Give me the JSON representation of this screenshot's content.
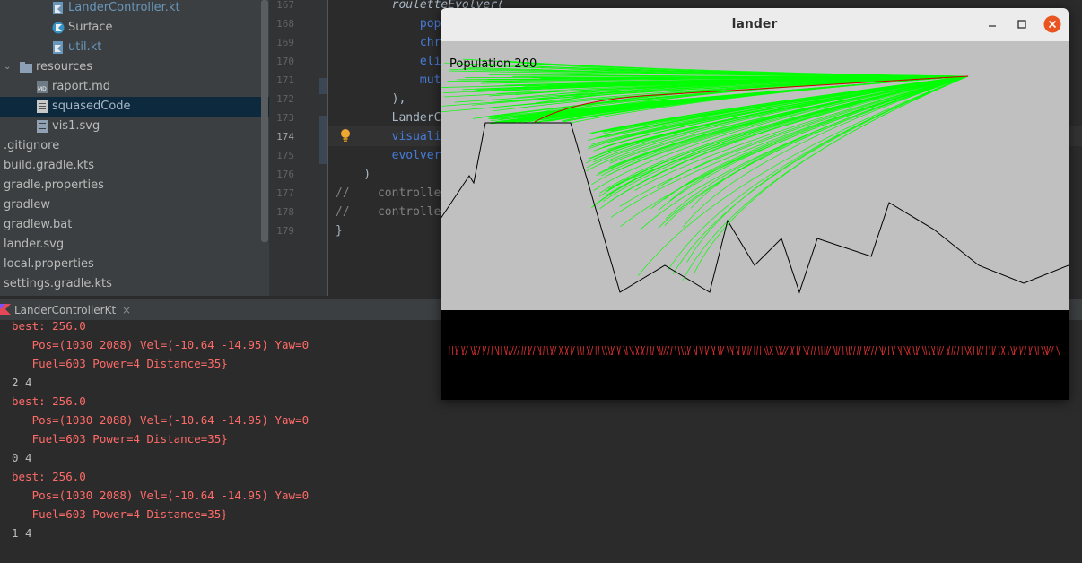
{
  "project_tree": {
    "items": [
      {
        "label": "LanderController.kt",
        "icon": "kotlin-file-icon",
        "style": "blue"
      },
      {
        "label": "Surface",
        "icon": "kotlin-class-icon",
        "style": "plain"
      },
      {
        "label": "util.kt",
        "icon": "kotlin-file-icon",
        "style": "blue"
      },
      {
        "label": "resources",
        "icon": "folder-icon",
        "style": "plain"
      },
      {
        "label": "raport.md",
        "icon": "markdown-file-icon",
        "style": "plain"
      },
      {
        "label": "squasedCode",
        "icon": "text-file-icon",
        "style": "sel"
      },
      {
        "label": "vis1.svg",
        "icon": "svg-file-icon",
        "style": "plain"
      },
      {
        "label": ".gitignore",
        "icon": "",
        "style": "plain"
      },
      {
        "label": "build.gradle.kts",
        "icon": "",
        "style": "plain"
      },
      {
        "label": "gradle.properties",
        "icon": "",
        "style": "plain"
      },
      {
        "label": "gradlew",
        "icon": "",
        "style": "plain"
      },
      {
        "label": "gradlew.bat",
        "icon": "",
        "style": "plain"
      },
      {
        "label": "lander.svg",
        "icon": "",
        "style": "plain"
      },
      {
        "label": "local.properties",
        "icon": "",
        "style": "plain"
      },
      {
        "label": "settings.gradle.kts",
        "icon": "",
        "style": "plain"
      }
    ]
  },
  "editor": {
    "line_numbers": [
      "167",
      "168",
      "169",
      "170",
      "171",
      "172",
      "173",
      "174",
      "175",
      "176",
      "177",
      "178",
      "179"
    ],
    "current_line": "174",
    "lines": [
      [
        {
          "t": "        ",
          "c": "plain"
        },
        {
          "t": "rouletteEvolver(",
          "c": "func"
        }
      ],
      [
        {
          "t": "            ",
          "c": "plain"
        },
        {
          "t": "pop",
          "c": "param"
        }
      ],
      [
        {
          "t": "            ",
          "c": "plain"
        },
        {
          "t": "chr",
          "c": "param"
        }
      ],
      [
        {
          "t": "            ",
          "c": "plain"
        },
        {
          "t": "eli",
          "c": "param"
        }
      ],
      [
        {
          "t": "            ",
          "c": "plain"
        },
        {
          "t": "mut",
          "c": "param"
        }
      ],
      [
        {
          "t": "        ),",
          "c": "plain"
        }
      ],
      [
        {
          "t": "        LanderC",
          "c": "plain"
        }
      ],
      [
        {
          "t": "        ",
          "c": "plain"
        },
        {
          "t": "visuali",
          "c": "param"
        }
      ],
      [
        {
          "t": "        ",
          "c": "plain"
        },
        {
          "t": "evolver",
          "c": "param"
        }
      ],
      [
        {
          "t": "    )",
          "c": "plain"
        }
      ],
      [
        {
          "t": "//    controlle",
          "c": "comment"
        }
      ],
      [
        {
          "t": "//    controlle",
          "c": "comment"
        }
      ],
      [
        {
          "t": "}",
          "c": "plain"
        }
      ]
    ]
  },
  "console": {
    "tab_label": "LanderControllerKt",
    "close_glyph": "×",
    "lines": [
      {
        "text": "best: 256.0",
        "style": "red"
      },
      {
        "text": "   Pos=(1030 2088) Vel=(-10.64 -14.95) Yaw=0",
        "style": "red"
      },
      {
        "text": "   Fuel=603 Power=4 Distance=35}",
        "style": "red"
      },
      {
        "text": "2 4",
        "style": "plain"
      },
      {
        "text": "best: 256.0",
        "style": "red"
      },
      {
        "text": "   Pos=(1030 2088) Vel=(-10.64 -14.95) Yaw=0",
        "style": "red"
      },
      {
        "text": "   Fuel=603 Power=4 Distance=35}",
        "style": "red"
      },
      {
        "text": "0 4",
        "style": "plain"
      },
      {
        "text": "best: 256.0",
        "style": "red"
      },
      {
        "text": "   Pos=(1030 2088) Vel=(-10.64 -14.95) Yaw=0",
        "style": "red"
      },
      {
        "text": "   Fuel=603 Power=4 Distance=35}",
        "style": "red"
      },
      {
        "text": "1 4",
        "style": "plain"
      }
    ]
  },
  "lander_window": {
    "title": "lander",
    "population_label": "Population 200",
    "colors": {
      "sky": "#c0c0c0",
      "terrain": "#000000",
      "trajectory": "#00ff00",
      "best_path": "#cc0000",
      "fitness_bars": "#e03030"
    }
  }
}
